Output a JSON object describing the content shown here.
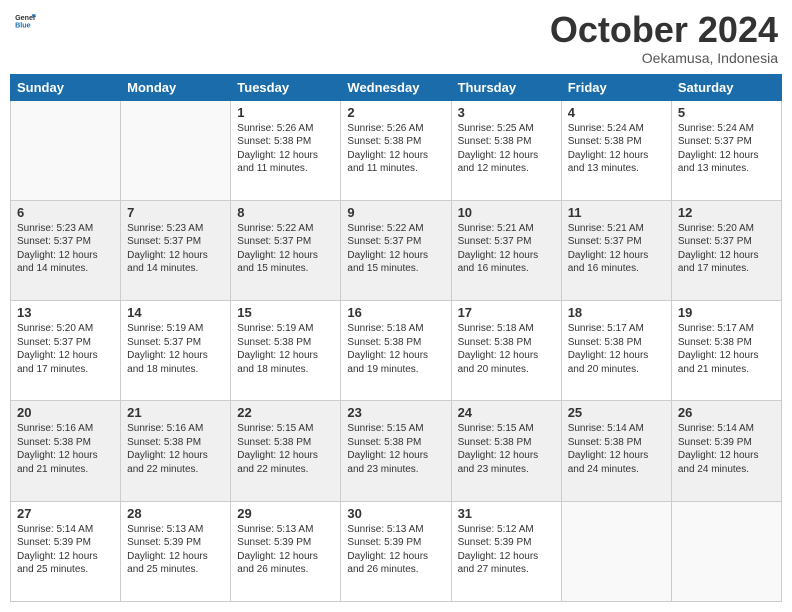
{
  "header": {
    "logo_general": "General",
    "logo_blue": "Blue",
    "month_title": "October 2024",
    "subtitle": "Oekamusa, Indonesia"
  },
  "weekdays": [
    "Sunday",
    "Monday",
    "Tuesday",
    "Wednesday",
    "Thursday",
    "Friday",
    "Saturday"
  ],
  "rows": [
    [
      {
        "day": "",
        "sunrise": "",
        "sunset": "",
        "daylight": ""
      },
      {
        "day": "",
        "sunrise": "",
        "sunset": "",
        "daylight": ""
      },
      {
        "day": "1",
        "sunrise": "Sunrise: 5:26 AM",
        "sunset": "Sunset: 5:38 PM",
        "daylight": "Daylight: 12 hours and 11 minutes."
      },
      {
        "day": "2",
        "sunrise": "Sunrise: 5:26 AM",
        "sunset": "Sunset: 5:38 PM",
        "daylight": "Daylight: 12 hours and 11 minutes."
      },
      {
        "day": "3",
        "sunrise": "Sunrise: 5:25 AM",
        "sunset": "Sunset: 5:38 PM",
        "daylight": "Daylight: 12 hours and 12 minutes."
      },
      {
        "day": "4",
        "sunrise": "Sunrise: 5:24 AM",
        "sunset": "Sunset: 5:38 PM",
        "daylight": "Daylight: 12 hours and 13 minutes."
      },
      {
        "day": "5",
        "sunrise": "Sunrise: 5:24 AM",
        "sunset": "Sunset: 5:37 PM",
        "daylight": "Daylight: 12 hours and 13 minutes."
      }
    ],
    [
      {
        "day": "6",
        "sunrise": "Sunrise: 5:23 AM",
        "sunset": "Sunset: 5:37 PM",
        "daylight": "Daylight: 12 hours and 14 minutes."
      },
      {
        "day": "7",
        "sunrise": "Sunrise: 5:23 AM",
        "sunset": "Sunset: 5:37 PM",
        "daylight": "Daylight: 12 hours and 14 minutes."
      },
      {
        "day": "8",
        "sunrise": "Sunrise: 5:22 AM",
        "sunset": "Sunset: 5:37 PM",
        "daylight": "Daylight: 12 hours and 15 minutes."
      },
      {
        "day": "9",
        "sunrise": "Sunrise: 5:22 AM",
        "sunset": "Sunset: 5:37 PM",
        "daylight": "Daylight: 12 hours and 15 minutes."
      },
      {
        "day": "10",
        "sunrise": "Sunrise: 5:21 AM",
        "sunset": "Sunset: 5:37 PM",
        "daylight": "Daylight: 12 hours and 16 minutes."
      },
      {
        "day": "11",
        "sunrise": "Sunrise: 5:21 AM",
        "sunset": "Sunset: 5:37 PM",
        "daylight": "Daylight: 12 hours and 16 minutes."
      },
      {
        "day": "12",
        "sunrise": "Sunrise: 5:20 AM",
        "sunset": "Sunset: 5:37 PM",
        "daylight": "Daylight: 12 hours and 17 minutes."
      }
    ],
    [
      {
        "day": "13",
        "sunrise": "Sunrise: 5:20 AM",
        "sunset": "Sunset: 5:37 PM",
        "daylight": "Daylight: 12 hours and 17 minutes."
      },
      {
        "day": "14",
        "sunrise": "Sunrise: 5:19 AM",
        "sunset": "Sunset: 5:37 PM",
        "daylight": "Daylight: 12 hours and 18 minutes."
      },
      {
        "day": "15",
        "sunrise": "Sunrise: 5:19 AM",
        "sunset": "Sunset: 5:38 PM",
        "daylight": "Daylight: 12 hours and 18 minutes."
      },
      {
        "day": "16",
        "sunrise": "Sunrise: 5:18 AM",
        "sunset": "Sunset: 5:38 PM",
        "daylight": "Daylight: 12 hours and 19 minutes."
      },
      {
        "day": "17",
        "sunrise": "Sunrise: 5:18 AM",
        "sunset": "Sunset: 5:38 PM",
        "daylight": "Daylight: 12 hours and 20 minutes."
      },
      {
        "day": "18",
        "sunrise": "Sunrise: 5:17 AM",
        "sunset": "Sunset: 5:38 PM",
        "daylight": "Daylight: 12 hours and 20 minutes."
      },
      {
        "day": "19",
        "sunrise": "Sunrise: 5:17 AM",
        "sunset": "Sunset: 5:38 PM",
        "daylight": "Daylight: 12 hours and 21 minutes."
      }
    ],
    [
      {
        "day": "20",
        "sunrise": "Sunrise: 5:16 AM",
        "sunset": "Sunset: 5:38 PM",
        "daylight": "Daylight: 12 hours and 21 minutes."
      },
      {
        "day": "21",
        "sunrise": "Sunrise: 5:16 AM",
        "sunset": "Sunset: 5:38 PM",
        "daylight": "Daylight: 12 hours and 22 minutes."
      },
      {
        "day": "22",
        "sunrise": "Sunrise: 5:15 AM",
        "sunset": "Sunset: 5:38 PM",
        "daylight": "Daylight: 12 hours and 22 minutes."
      },
      {
        "day": "23",
        "sunrise": "Sunrise: 5:15 AM",
        "sunset": "Sunset: 5:38 PM",
        "daylight": "Daylight: 12 hours and 23 minutes."
      },
      {
        "day": "24",
        "sunrise": "Sunrise: 5:15 AM",
        "sunset": "Sunset: 5:38 PM",
        "daylight": "Daylight: 12 hours and 23 minutes."
      },
      {
        "day": "25",
        "sunrise": "Sunrise: 5:14 AM",
        "sunset": "Sunset: 5:38 PM",
        "daylight": "Daylight: 12 hours and 24 minutes."
      },
      {
        "day": "26",
        "sunrise": "Sunrise: 5:14 AM",
        "sunset": "Sunset: 5:39 PM",
        "daylight": "Daylight: 12 hours and 24 minutes."
      }
    ],
    [
      {
        "day": "27",
        "sunrise": "Sunrise: 5:14 AM",
        "sunset": "Sunset: 5:39 PM",
        "daylight": "Daylight: 12 hours and 25 minutes."
      },
      {
        "day": "28",
        "sunrise": "Sunrise: 5:13 AM",
        "sunset": "Sunset: 5:39 PM",
        "daylight": "Daylight: 12 hours and 25 minutes."
      },
      {
        "day": "29",
        "sunrise": "Sunrise: 5:13 AM",
        "sunset": "Sunset: 5:39 PM",
        "daylight": "Daylight: 12 hours and 26 minutes."
      },
      {
        "day": "30",
        "sunrise": "Sunrise: 5:13 AM",
        "sunset": "Sunset: 5:39 PM",
        "daylight": "Daylight: 12 hours and 26 minutes."
      },
      {
        "day": "31",
        "sunrise": "Sunrise: 5:12 AM",
        "sunset": "Sunset: 5:39 PM",
        "daylight": "Daylight: 12 hours and 27 minutes."
      },
      {
        "day": "",
        "sunrise": "",
        "sunset": "",
        "daylight": ""
      },
      {
        "day": "",
        "sunrise": "",
        "sunset": "",
        "daylight": ""
      }
    ]
  ]
}
